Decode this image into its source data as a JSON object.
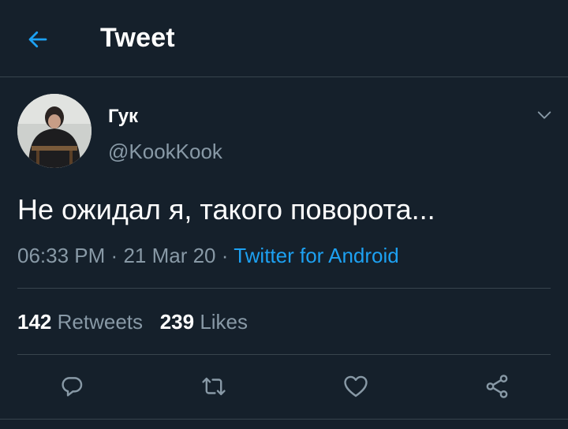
{
  "header": {
    "title": "Tweet",
    "back_icon": "arrow-left-icon"
  },
  "tweet": {
    "author_name": "Гук",
    "author_handle": "@KookKook",
    "text": "Не ожидал я, такого поворота...",
    "time": "06:33 PM",
    "separator": "·",
    "date": "21 Mar 20",
    "source": "Twitter for Android"
  },
  "stats": {
    "retweets_count": "142",
    "retweets_label": "Retweets",
    "likes_count": "239",
    "likes_label": "Likes"
  },
  "actions": [
    "reply-icon",
    "retweet-icon",
    "like-icon",
    "share-icon"
  ],
  "colors": {
    "background": "#15202b",
    "accent": "#1da1f2",
    "secondary_text": "#8899a6",
    "divider": "#38444d"
  }
}
